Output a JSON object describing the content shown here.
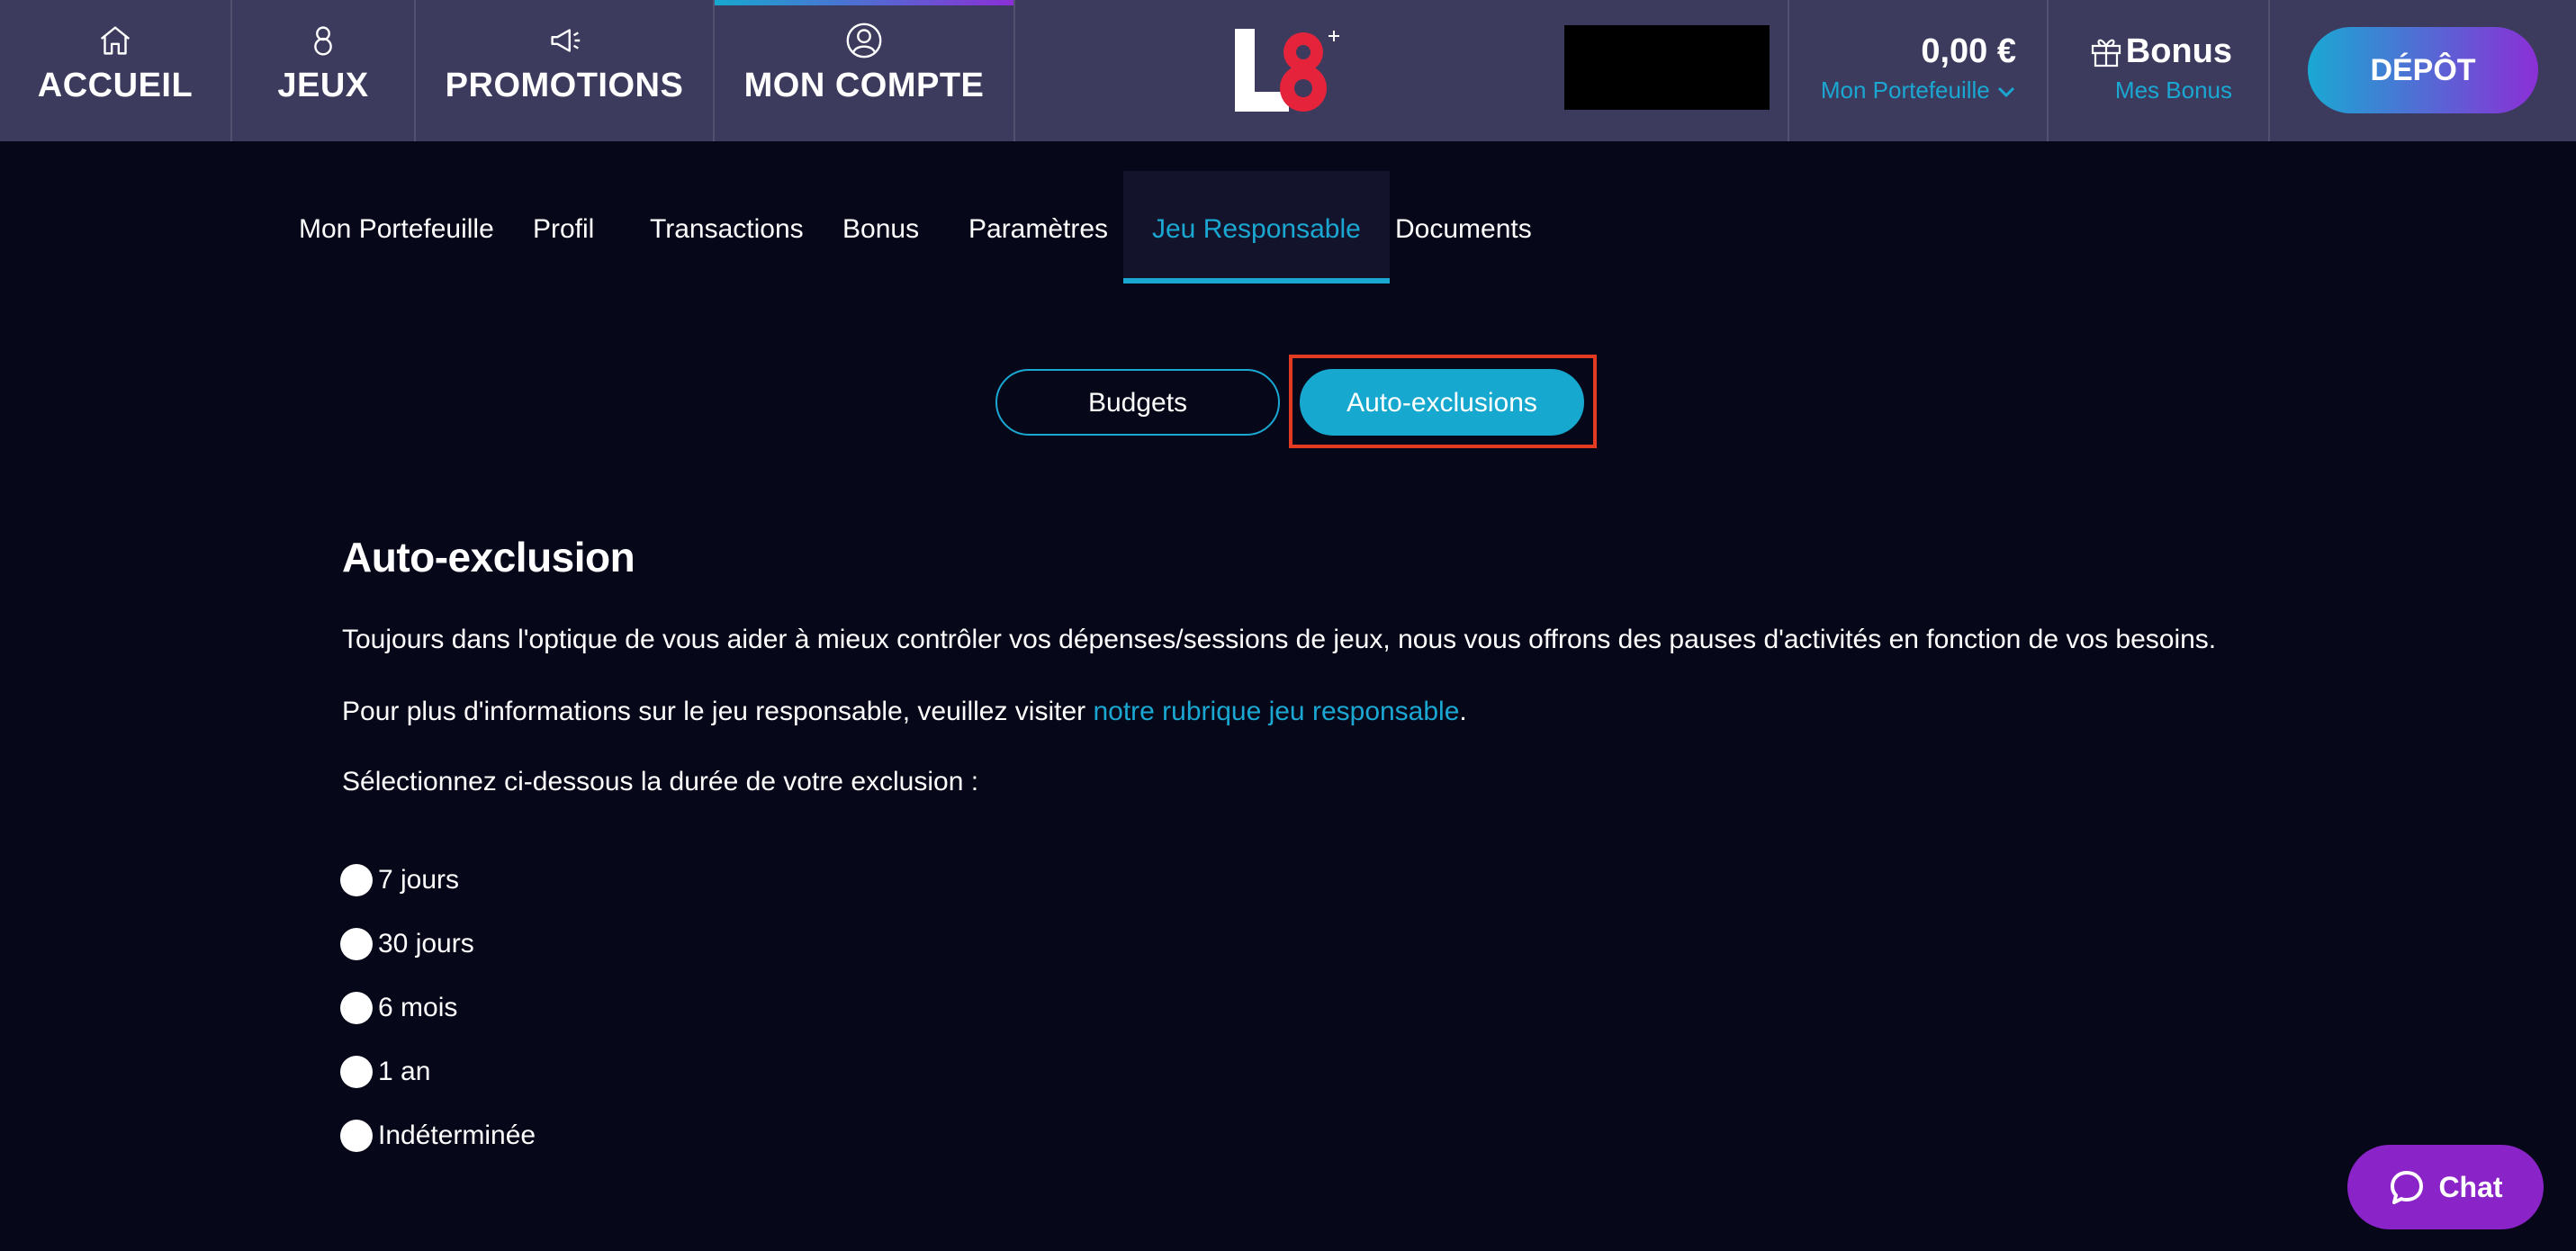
{
  "header": {
    "nav": [
      {
        "label": "ACCUEIL",
        "icon": "home-icon"
      },
      {
        "label": "JEUX",
        "icon": "eight-icon"
      },
      {
        "label": "PROMOTIONS",
        "icon": "megaphone-icon"
      },
      {
        "label": "MON COMPTE",
        "icon": "user-icon",
        "active": true
      }
    ],
    "logo_text": "L8",
    "wallet": {
      "amount": "0,00 €",
      "label": "Mon Portefeuille"
    },
    "bonus": {
      "title": "Bonus",
      "label": "Mes Bonus"
    },
    "depot_label": "DÉPÔT"
  },
  "subtabs": [
    {
      "label": "Mon Portefeuille"
    },
    {
      "label": "Profil"
    },
    {
      "label": "Transactions"
    },
    {
      "label": "Bonus"
    },
    {
      "label": "Paramètres"
    },
    {
      "label": "Jeu Responsable",
      "active": true
    },
    {
      "label": "Documents"
    }
  ],
  "toggle": {
    "budgets": "Budgets",
    "auto_exclusions": "Auto-exclusions",
    "selected": "Auto-exclusions"
  },
  "content": {
    "title": "Auto-exclusion",
    "para1": "Toujours dans l'optique de vous aider à mieux contrôler vos dépenses/sessions de jeux, nous vous offrons des pauses d'activités en fonction de vos besoins.",
    "para2_prefix": "Pour plus d'informations sur le jeu responsable, veuillez visiter ",
    "para2_link": "notre rubrique jeu responsable",
    "para2_suffix": ".",
    "para3": "Sélectionnez ci-dessous la durée de votre exclusion :",
    "options": [
      "7 jours",
      "30 jours",
      "6 mois",
      "1 an",
      "Indéterminée"
    ]
  },
  "chat_label": "Chat",
  "colors": {
    "accent": "#1aa8d3",
    "purple": "#8b2fd6",
    "header_bg": "#3c3b5e",
    "page_bg": "#07071a",
    "highlight": "#e23b22"
  }
}
